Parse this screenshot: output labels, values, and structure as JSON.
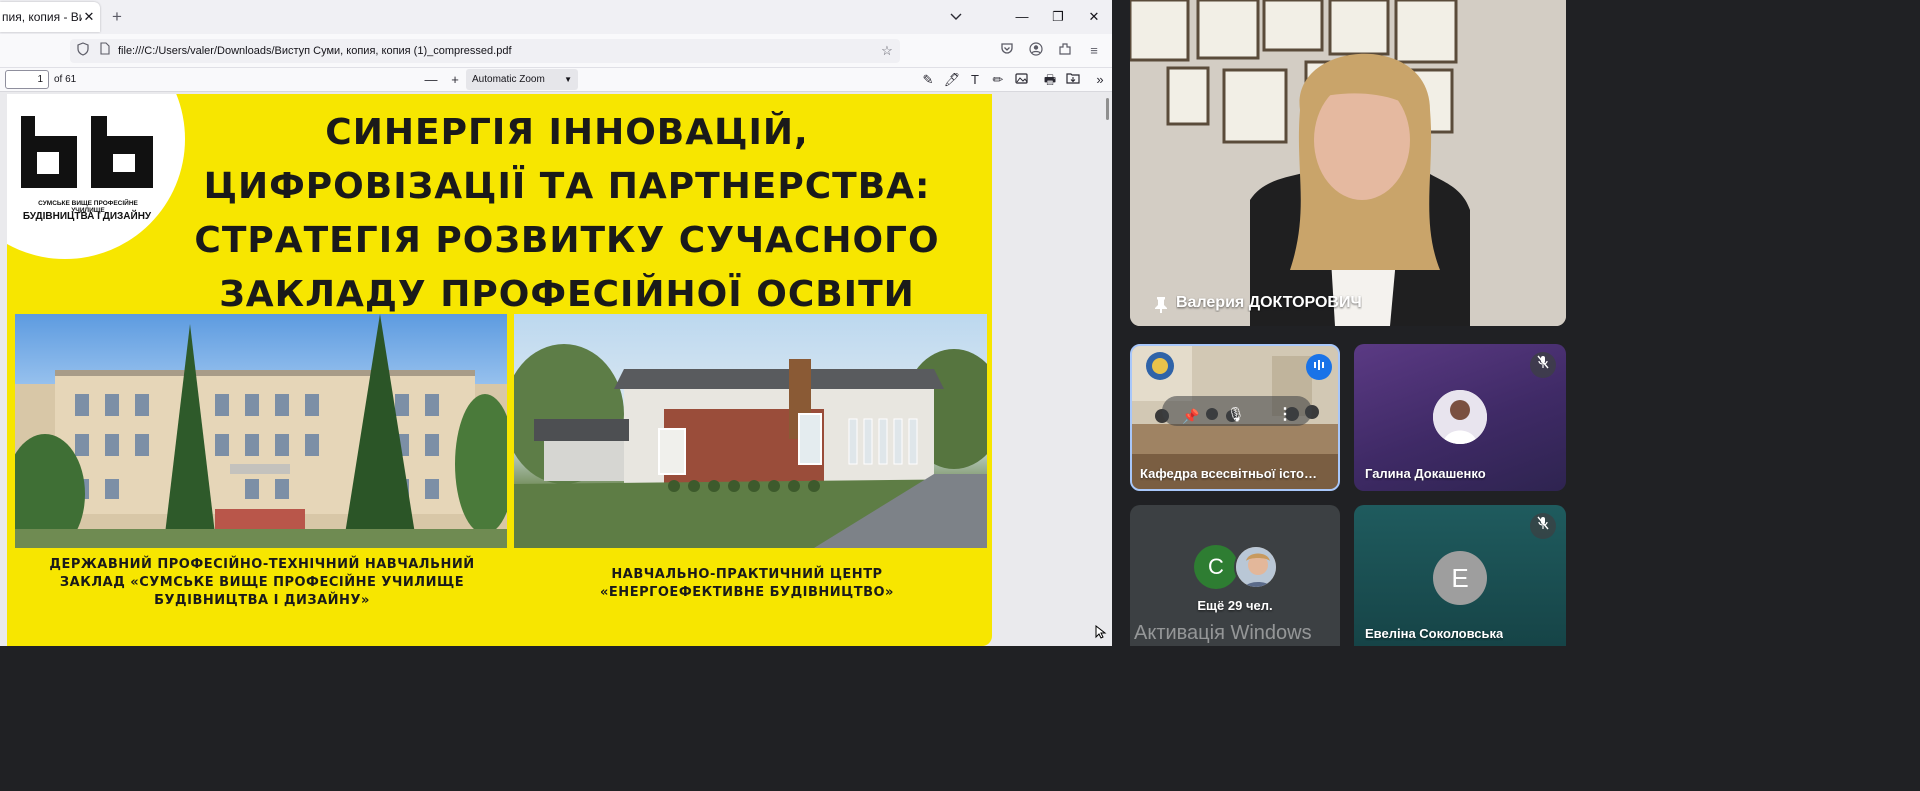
{
  "browser": {
    "tab_title": "пия, копия - Висту",
    "url": "file:///C:/Users/valer/Downloads/Виступ Суми, копия, копия (1)_compressed.pdf"
  },
  "pdf_toolbar": {
    "page_number": "1",
    "page_of": "of 61",
    "zoom": "Automatic Zoom"
  },
  "slide": {
    "logo_small": "СУМСЬКЕ ВИЩЕ ПРОФЕСІЙНЕ УЧИЛИЩЕ",
    "logo_big": "БУДІВНИЦТВА І ДИЗАЙНУ",
    "title_lines": [
      "СИНЕРГІЯ ІННОВАЦІЙ,",
      "ЦИФРОВІЗАЦІЇ ТА ПАРТНЕРСТВА:",
      "СТРАТЕГІЯ РОЗВИТКУ СУЧАСНОГО",
      "ЗАКЛАДУ ПРОФЕСІЙНОЇ ОСВІТИ"
    ],
    "caption_left": [
      "ДЕРЖАВНИЙ ПРОФЕСІЙНО-ТЕХНІЧНИЙ НАВЧАЛЬНИЙ",
      "ЗАКЛАД «СУМСЬКЕ ВИЩЕ ПРОФЕСІЙНЕ УЧИЛИЩЕ",
      "БУДІВНИЦТВА І ДИЗАЙНУ»"
    ],
    "caption_right": [
      "НАВЧАЛЬНО-ПРАКТИЧНИЙ ЦЕНТР",
      "«ЕНЕРГОЕФЕКТИВНЕ БУДІВНИЦТВО»"
    ],
    "background_color": "#f7e600"
  },
  "meet": {
    "main_speaker": "Валерия ДОКТОРОВИЧ",
    "tiles": {
      "kafedra": "Кафедра всесвітньої істо…",
      "galyna": "Галина Докашенко",
      "more_count": "Ещё 29 чел.",
      "more_avatar_letter": "С",
      "evelina": "Евеліна Соколовська",
      "evelina_letter": "Е"
    },
    "watermark": "Активація Windows"
  }
}
